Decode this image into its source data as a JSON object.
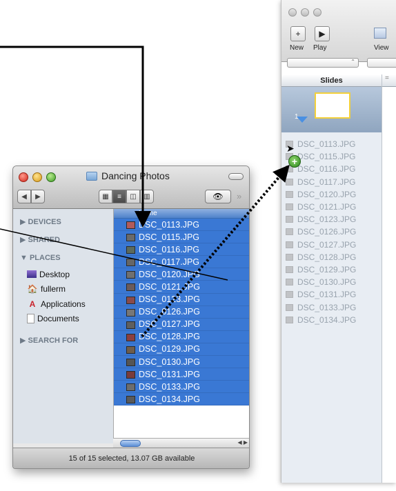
{
  "keynote": {
    "toolbar": [
      {
        "label": "New",
        "glyph": "+"
      },
      {
        "label": "Play",
        "glyph": "▶"
      },
      {
        "label": "View",
        "glyph": ""
      }
    ],
    "slides_header": "Slides",
    "slide_number": "1",
    "ghost_files": [
      "DSC_0113.JPG",
      "DSC_0115.JPG",
      "DSC_0116.JPG",
      "DSC_0117.JPG",
      "DSC_0120.JPG",
      "DSC_0121.JPG",
      "DSC_0123.JPG",
      "DSC_0126.JPG",
      "DSC_0127.JPG",
      "DSC_0128.JPG",
      "DSC_0129.JPG",
      "DSC_0130.JPG",
      "DSC_0131.JPG",
      "DSC_0133.JPG",
      "DSC_0134.JPG"
    ]
  },
  "finder": {
    "title": "Dancing Photos",
    "sidebar": {
      "devices": "DEVICES",
      "shared": "SHARED",
      "places": "PLACES",
      "places_items": [
        "Desktop",
        "fullerm",
        "Applications",
        "Documents"
      ],
      "search_for": "SEARCH FOR"
    },
    "column_header": "Name",
    "files": [
      "DSC_0113.JPG",
      "DSC_0115.JPG",
      "DSC_0116.JPG",
      "DSC_0117.JPG",
      "DSC_0120.JPG",
      "DSC_0121.JPG",
      "DSC_0123.JPG",
      "DSC_0126.JPG",
      "DSC_0127.JPG",
      "DSC_0128.JPG",
      "DSC_0129.JPG",
      "DSC_0130.JPG",
      "DSC_0131.JPG",
      "DSC_0133.JPG",
      "DSC_0134.JPG"
    ],
    "status": "15 of 15 selected, 13.07 GB available"
  },
  "colors": {
    "selection": "#3a78d4",
    "sidebar": "#dde3ea",
    "keynote_sidebar": "#e8edf3",
    "slide_border": "#f3d03a",
    "plus_badge": "#2f8a1f"
  }
}
